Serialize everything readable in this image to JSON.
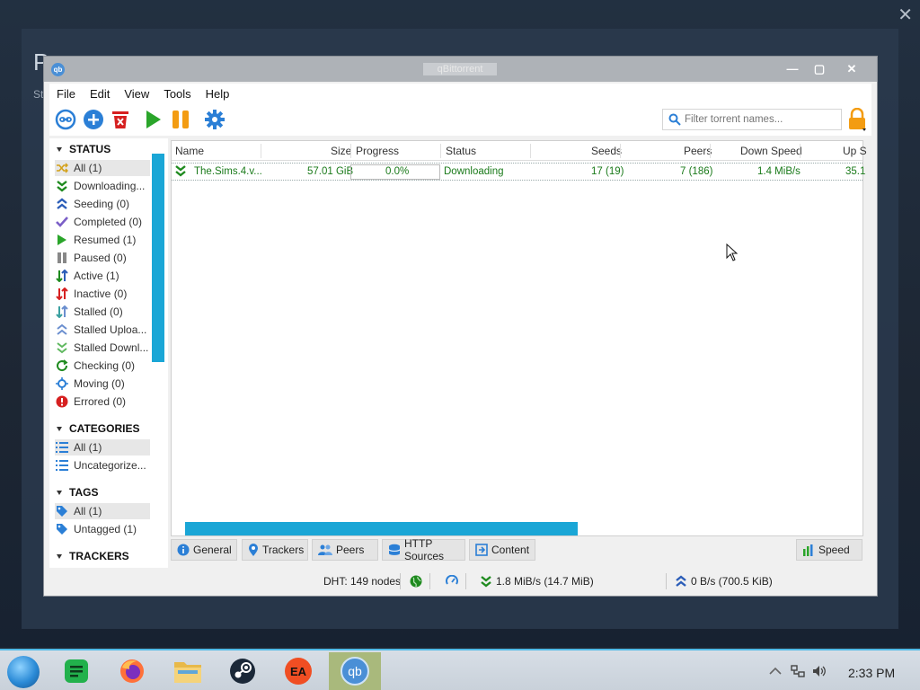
{
  "background": {
    "title_partial": "P",
    "subtitle_partial": "St",
    "close_glyph": "✕"
  },
  "window": {
    "app_icon": "qb",
    "title": "qBittorrent",
    "controls": {
      "minimize": "—",
      "maximize": "▢",
      "close": "✕"
    }
  },
  "menu": [
    "File",
    "Edit",
    "View",
    "Tools",
    "Help"
  ],
  "toolbar": {
    "buttons": [
      "add-link-icon",
      "add-torrent-icon",
      "delete-icon",
      "resume-icon",
      "pause-icon",
      "options-gear-icon"
    ],
    "search_placeholder": "Filter torrent names..."
  },
  "sidebar": {
    "status_header": "STATUS",
    "status_items": [
      {
        "label": "All (1)",
        "icon": "shuffle-icon",
        "color": "#d4a017",
        "selected": true
      },
      {
        "label": "Downloading...",
        "icon": "download-chevrons-icon",
        "color": "#1e8a1e"
      },
      {
        "label": "Seeding (0)",
        "icon": "upload-chevrons-icon",
        "color": "#2b5db8"
      },
      {
        "label": "Completed (0)",
        "icon": "check-icon",
        "color": "#7b5fc7"
      },
      {
        "label": "Resumed (1)",
        "icon": "play-icon",
        "color": "#2aa52a"
      },
      {
        "label": "Paused (0)",
        "icon": "pause-icon",
        "color": "#888888"
      },
      {
        "label": "Active (1)",
        "icon": "active-arrows-icon",
        "color": "#1e8a1e"
      },
      {
        "label": "Inactive (0)",
        "icon": "inactive-arrows-icon",
        "color": "#d62020"
      },
      {
        "label": "Stalled (0)",
        "icon": "stalled-arrows-icon",
        "color": "#3aa0a0"
      },
      {
        "label": "Stalled Uploa...",
        "icon": "stalled-upload-icon",
        "color": "#6b8fcf"
      },
      {
        "label": "Stalled Downl...",
        "icon": "stalled-download-icon",
        "color": "#5fb85f"
      },
      {
        "label": "Checking (0)",
        "icon": "refresh-icon",
        "color": "#1e8a1e"
      },
      {
        "label": "Moving (0)",
        "icon": "move-icon",
        "color": "#2b7fd6"
      },
      {
        "label": "Errored (0)",
        "icon": "error-icon",
        "color": "#d62020"
      }
    ],
    "categories_header": "CATEGORIES",
    "category_items": [
      {
        "label": "All (1)",
        "icon": "list-icon",
        "selected": true
      },
      {
        "label": "Uncategorize...",
        "icon": "list-icon",
        "selected": false
      }
    ],
    "tags_header": "TAGS",
    "tag_items": [
      {
        "label": "All (1)",
        "icon": "tag-icon",
        "selected": true
      },
      {
        "label": "Untagged (1)",
        "icon": "tag-icon",
        "selected": false
      }
    ],
    "trackers_header": "TRACKERS"
  },
  "table": {
    "columns": [
      "Name",
      "Size",
      "Progress",
      "Status",
      "Seeds",
      "Peers",
      "Down Speed",
      "Up S"
    ],
    "rows": [
      {
        "name": "The.Sims.4.v...",
        "size": "57.01 GiB",
        "progress": "0.0%",
        "status": "Downloading",
        "seeds": "17 (19)",
        "peers": "7 (186)",
        "down_speed": "1.4 MiB/s",
        "up_speed": "35.1"
      }
    ]
  },
  "tabs": [
    "General",
    "Trackers",
    "Peers",
    "HTTP Sources",
    "Content",
    "Speed"
  ],
  "statusbar": {
    "dht": "DHT: 149 nodes",
    "down": "1.8 MiB/s (14.7 MiB)",
    "up": "0 B/s (700.5 KiB)"
  },
  "taskbar": {
    "apps": [
      "start-orb-icon",
      "notes-icon",
      "firefox-icon",
      "file-explorer-icon",
      "steam-icon",
      "ea-icon",
      "qbittorrent-icon"
    ],
    "ea_label": "EA",
    "qb_label": "qb",
    "clock": "2:33 PM"
  },
  "colors": {
    "accent": "#1aa6d6",
    "download_green": "#1e8a1e",
    "upload_blue": "#2b5db8",
    "lock_orange": "#f39c12"
  }
}
